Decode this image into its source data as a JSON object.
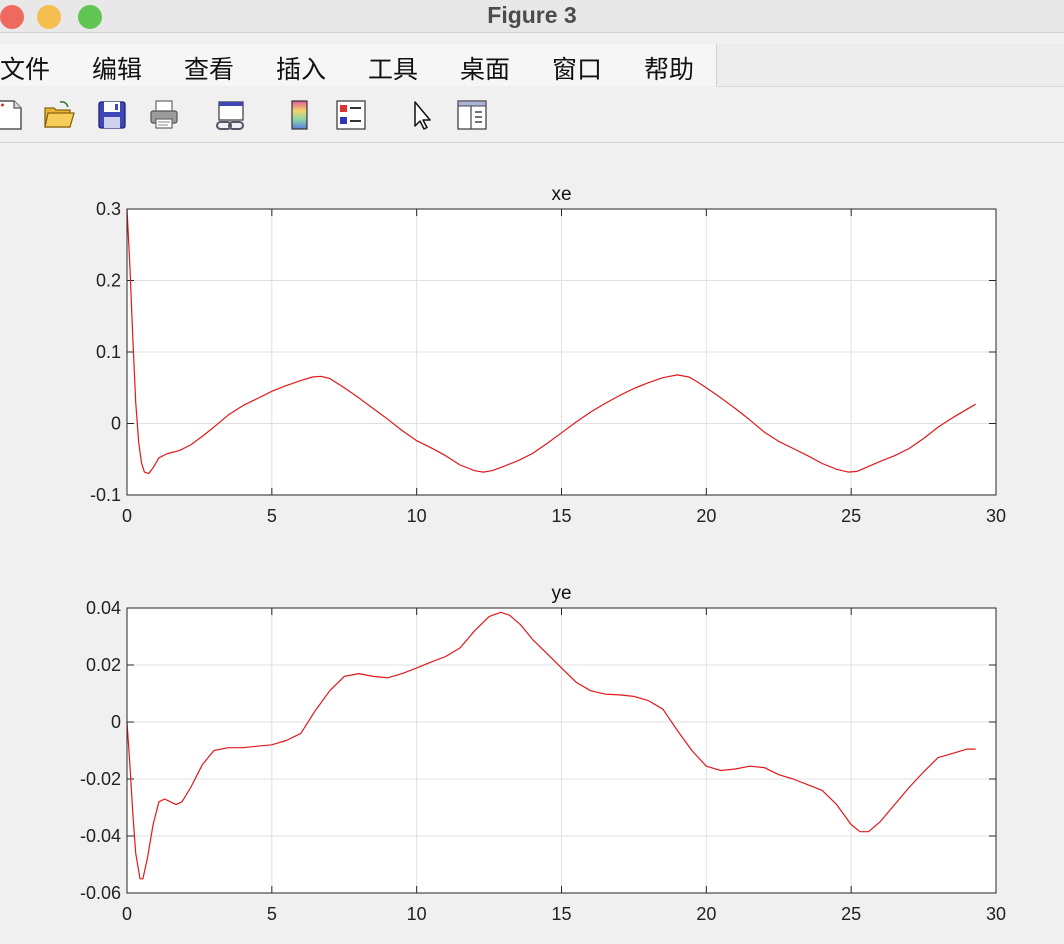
{
  "window": {
    "title": "Figure 3",
    "traffic_lights": [
      {
        "name": "close",
        "color": "#ee6a5e"
      },
      {
        "name": "minimize",
        "color": "#f5bf4f"
      },
      {
        "name": "zoom",
        "color": "#61c554"
      }
    ]
  },
  "menu": {
    "items": [
      "文件",
      "编辑",
      "查看",
      "插入",
      "工具",
      "桌面",
      "窗口",
      "帮助"
    ]
  },
  "toolbar": {
    "buttons": [
      {
        "name": "new-figure-icon"
      },
      {
        "name": "open-file-icon"
      },
      {
        "name": "save-icon"
      },
      {
        "name": "print-icon"
      },
      {
        "name": "link-plot-icon"
      },
      {
        "name": "colorbar-icon"
      },
      {
        "name": "legend-icon"
      },
      {
        "name": "pointer-icon"
      },
      {
        "name": "property-inspector-icon"
      }
    ]
  },
  "chart_data": [
    {
      "type": "line",
      "title": "xe",
      "xlim": [
        0,
        30
      ],
      "ylim": [
        -0.1,
        0.3
      ],
      "xticks": [
        0,
        5,
        10,
        15,
        20,
        25,
        30
      ],
      "yticks": [
        -0.1,
        0,
        0.1,
        0.2,
        0.3
      ],
      "xtick_labels": [
        "0",
        "5",
        "10",
        "15",
        "20",
        "25",
        "30"
      ],
      "ytick_labels": [
        "-0.1",
        "0",
        "0.1",
        "0.2",
        "0.3"
      ],
      "grid": true,
      "series": [
        {
          "color": "#e0191b",
          "x": [
            0,
            0.1,
            0.2,
            0.3,
            0.4,
            0.5,
            0.6,
            0.75,
            0.9,
            1.1,
            1.4,
            1.8,
            2.2,
            2.6,
            3.0,
            3.5,
            4.0,
            4.5,
            5.0,
            5.5,
            6.0,
            6.4,
            6.7,
            7.0,
            7.5,
            8.0,
            8.5,
            9.0,
            9.5,
            10.0,
            10.5,
            11.0,
            11.5,
            12.0,
            12.3,
            12.6,
            13.0,
            13.5,
            14.0,
            14.5,
            15.0,
            15.5,
            16.0,
            16.5,
            17.0,
            17.5,
            18.0,
            18.5,
            19.0,
            19.4,
            19.7,
            20.0,
            20.5,
            21.0,
            21.5,
            22.0,
            22.5,
            23.0,
            23.5,
            24.0,
            24.5,
            24.9,
            25.2,
            25.6,
            26.0,
            26.5,
            27.0,
            27.5,
            28.0,
            28.5,
            29.0,
            29.3
          ],
          "y": [
            0.3,
            0.22,
            0.12,
            0.03,
            -0.025,
            -0.055,
            -0.068,
            -0.07,
            -0.062,
            -0.048,
            -0.042,
            -0.038,
            -0.03,
            -0.018,
            -0.005,
            0.012,
            0.025,
            0.035,
            0.045,
            0.053,
            0.06,
            0.065,
            0.066,
            0.063,
            0.05,
            0.036,
            0.021,
            0.006,
            -0.01,
            -0.024,
            -0.034,
            -0.045,
            -0.058,
            -0.066,
            -0.068,
            -0.066,
            -0.06,
            -0.052,
            -0.042,
            -0.028,
            -0.013,
            0.002,
            0.016,
            0.028,
            0.039,
            0.049,
            0.057,
            0.064,
            0.068,
            0.065,
            0.058,
            0.05,
            0.036,
            0.021,
            0.005,
            -0.012,
            -0.025,
            -0.035,
            -0.045,
            -0.056,
            -0.064,
            -0.068,
            -0.067,
            -0.06,
            -0.053,
            -0.045,
            -0.035,
            -0.021,
            -0.005,
            0.008,
            0.02,
            0.027
          ]
        }
      ]
    },
    {
      "type": "line",
      "title": "ye",
      "xlim": [
        0,
        30
      ],
      "ylim": [
        -0.06,
        0.04
      ],
      "xticks": [
        0,
        5,
        10,
        15,
        20,
        25,
        30
      ],
      "yticks": [
        -0.06,
        -0.04,
        -0.02,
        0,
        0.02,
        0.04
      ],
      "xtick_labels": [
        "0",
        "5",
        "10",
        "15",
        "20",
        "25",
        "30"
      ],
      "ytick_labels": [
        "-0.06",
        "-0.04",
        "-0.02",
        "0",
        "0.02",
        "0.04"
      ],
      "grid": true,
      "series": [
        {
          "color": "#e0191b",
          "x": [
            0,
            0.1,
            0.2,
            0.3,
            0.45,
            0.55,
            0.7,
            0.9,
            1.1,
            1.3,
            1.5,
            1.7,
            1.9,
            2.2,
            2.6,
            3.0,
            3.5,
            4.0,
            4.5,
            5.0,
            5.5,
            6.0,
            6.5,
            7.0,
            7.5,
            8.0,
            8.5,
            9.0,
            9.5,
            10.0,
            10.5,
            11.0,
            11.5,
            12.0,
            12.5,
            12.9,
            13.2,
            13.6,
            14.0,
            14.5,
            15.0,
            15.5,
            16.0,
            16.5,
            17.0,
            17.5,
            18.0,
            18.5,
            19.0,
            19.5,
            20.0,
            20.5,
            21.0,
            21.5,
            22.0,
            22.5,
            23.0,
            23.5,
            24.0,
            24.5,
            25.0,
            25.3,
            25.6,
            26.0,
            26.5,
            27.0,
            27.5,
            28.0,
            28.5,
            29.0,
            29.3
          ],
          "y": [
            0.0,
            -0.015,
            -0.032,
            -0.046,
            -0.055,
            -0.055,
            -0.048,
            -0.036,
            -0.028,
            -0.027,
            -0.028,
            -0.029,
            -0.028,
            -0.023,
            -0.015,
            -0.01,
            -0.009,
            -0.009,
            -0.0085,
            -0.008,
            -0.0065,
            -0.004,
            0.004,
            0.011,
            0.016,
            0.017,
            0.016,
            0.0155,
            0.017,
            0.019,
            0.021,
            0.023,
            0.026,
            0.032,
            0.037,
            0.0385,
            0.0375,
            0.034,
            0.029,
            0.024,
            0.019,
            0.014,
            0.011,
            0.0098,
            0.0095,
            0.009,
            0.0075,
            0.0045,
            -0.003,
            -0.01,
            -0.0155,
            -0.017,
            -0.0165,
            -0.0155,
            -0.016,
            -0.0185,
            -0.02,
            -0.022,
            -0.024,
            -0.029,
            -0.036,
            -0.0385,
            -0.0385,
            -0.035,
            -0.029,
            -0.023,
            -0.0175,
            -0.0125,
            -0.011,
            -0.0095,
            -0.0095
          ]
        }
      ]
    }
  ]
}
